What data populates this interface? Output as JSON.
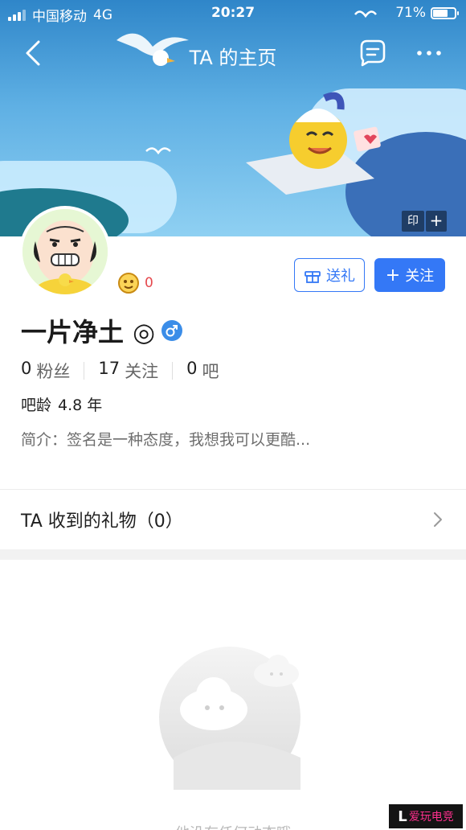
{
  "status_bar": {
    "carrier": "中国移动",
    "network": "4G",
    "time": "20:27",
    "battery_percent": "71%",
    "battery_level": 0.71,
    "signal_bars": 3
  },
  "nav": {
    "title": "TA 的主页"
  },
  "banner": {
    "stamp_label": "印",
    "plus_label": "+"
  },
  "profile": {
    "level": "0",
    "name": "一片净土 ◎",
    "gift_button": "送礼",
    "follow_button": "关注",
    "follow_plus": "+",
    "stats": [
      {
        "value": "0",
        "label": "粉丝"
      },
      {
        "value": "17",
        "label": "关注"
      },
      {
        "value": "0",
        "label": "吧"
      }
    ],
    "age_label": "吧龄",
    "age_value": "4.8 年",
    "bio": "简介：签名是一种态度，我想我可以更酷..."
  },
  "gifts_row": {
    "label": "TA 收到的礼物（0）"
  },
  "empty_state": {
    "text": "他没有任何动态哦"
  },
  "watermark": {
    "text": "爱玩电竞"
  },
  "colors": {
    "accent": "#3478f6",
    "level_red": "#e5484d",
    "banner_top": "#2f86c9"
  }
}
